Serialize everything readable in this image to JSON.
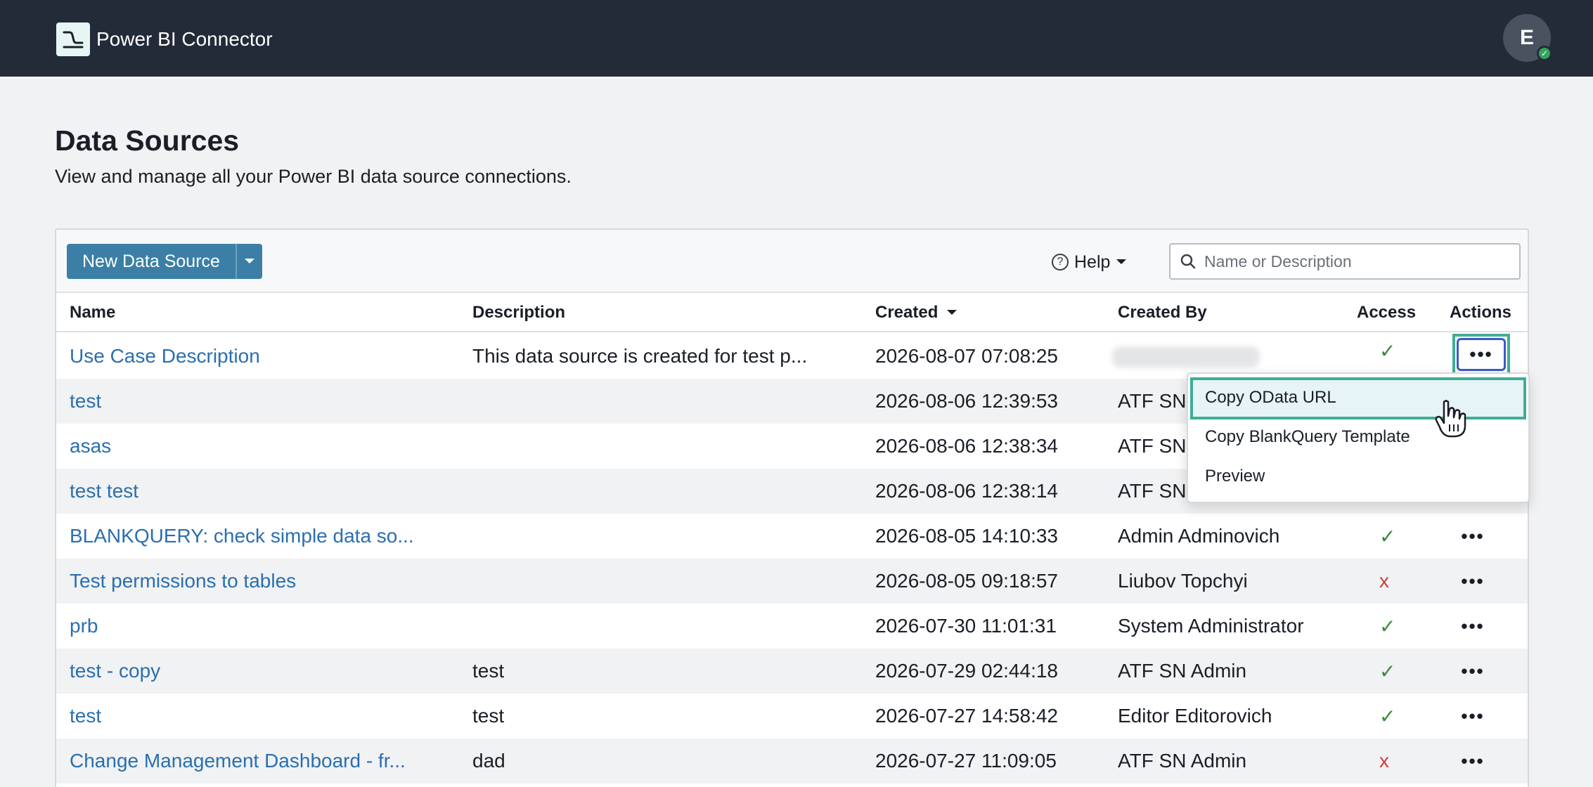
{
  "header": {
    "app_title": "Power BI Connector",
    "avatar_initial": "E",
    "avatar_status": "✓"
  },
  "page": {
    "title": "Data Sources",
    "subtitle": "View and manage all your Power BI data source connections."
  },
  "toolbar": {
    "new_button_label": "New Data Source",
    "help_label": "Help",
    "help_glyph": "?",
    "search_placeholder": "Name or Description"
  },
  "table": {
    "columns": {
      "name": "Name",
      "description": "Description",
      "created": "Created",
      "created_by": "Created By",
      "access": "Access",
      "actions": "Actions"
    },
    "rows": [
      {
        "name": "Use Case Description",
        "description": "This data source is created for test p...",
        "created": "2026-08-07 07:08:25",
        "created_by": "",
        "access": "✓"
      },
      {
        "name": "test",
        "description": "",
        "created": "2026-08-06 12:39:53",
        "created_by": "ATF SN",
        "access": ""
      },
      {
        "name": "asas",
        "description": "",
        "created": "2026-08-06 12:38:34",
        "created_by": "ATF SN",
        "access": ""
      },
      {
        "name": "test test",
        "description": "",
        "created": "2026-08-06 12:38:14",
        "created_by": "ATF SN",
        "access": ""
      },
      {
        "name": "BLANKQUERY: check simple data so...",
        "description": "",
        "created": "2026-08-05 14:10:33",
        "created_by": "Admin Adminovich",
        "access": "✓"
      },
      {
        "name": "Test permissions to tables",
        "description": "",
        "created": "2026-08-05 09:18:57",
        "created_by": "Liubov Topchyi",
        "access": "x"
      },
      {
        "name": "prb",
        "description": "",
        "created": "2026-07-30 11:01:31",
        "created_by": "System Administrator",
        "access": "✓"
      },
      {
        "name": "test - copy",
        "description": "test",
        "created": "2026-07-29 02:44:18",
        "created_by": "ATF SN Admin",
        "access": "✓"
      },
      {
        "name": "test",
        "description": "test",
        "created": "2026-07-27 14:58:42",
        "created_by": "Editor Editorovich",
        "access": "✓"
      },
      {
        "name": "Change Management Dashboard - fr...",
        "description": "dad",
        "created": "2026-07-27 11:09:05",
        "created_by": "ATF SN Admin",
        "access": "x"
      }
    ],
    "actions_glyph": "•••"
  },
  "menu": {
    "items": [
      "Copy OData URL",
      "Copy BlankQuery Template",
      "Preview"
    ]
  },
  "colors": {
    "header_bg": "#232b38",
    "primary_button": "#3b7fa6",
    "link": "#2a6fb0",
    "access_ok": "#3a8a3a",
    "access_denied": "#d23b3b",
    "highlight_frame": "#3fae96"
  }
}
